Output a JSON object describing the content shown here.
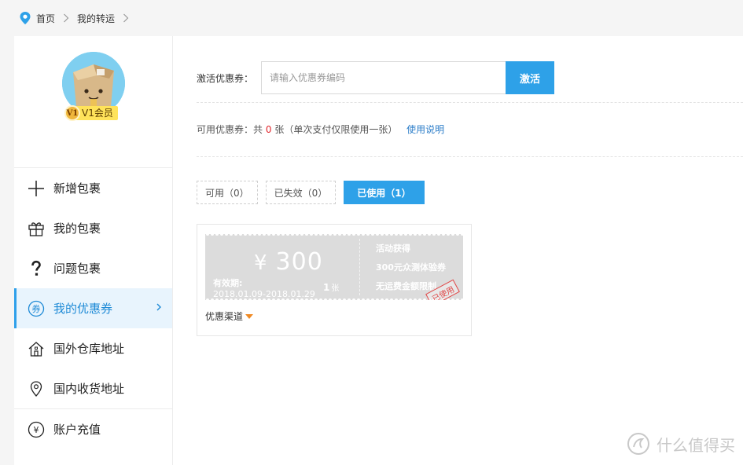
{
  "breadcrumb": {
    "home": "首页",
    "current": "我的转运"
  },
  "profile": {
    "vip_badge": "V1",
    "vip_label": "V1会员"
  },
  "sidebar": {
    "items": [
      {
        "label": "新增包裹",
        "icon": "plus-icon"
      },
      {
        "label": "我的包裹",
        "icon": "gift-box-icon"
      },
      {
        "label": "问题包裹",
        "icon": "question-icon"
      },
      {
        "label": "我的优惠券",
        "icon": "coupon-icon",
        "icon_char": "券",
        "active": true
      },
      {
        "label": "国外仓库地址",
        "icon": "house-icon"
      },
      {
        "label": "国内收货地址",
        "icon": "location-pin-icon"
      },
      {
        "label": "账户充值",
        "icon": "yen-icon",
        "icon_char": "¥"
      }
    ]
  },
  "activate": {
    "label": "激活优惠券：",
    "placeholder": "请输入优惠券编码",
    "button": "激活"
  },
  "info": {
    "prefix": "可用优惠券：共",
    "count": "0",
    "suffix": "张（单次支付仅限使用一张）",
    "link": "使用说明"
  },
  "tabs": [
    {
      "label": "可用（0）"
    },
    {
      "label": "已失效（0）"
    },
    {
      "label": "已使用（1）",
      "active": true
    }
  ],
  "coupon": {
    "currency": "¥",
    "amount": "300",
    "valid_label": "有效期:",
    "valid_range": "2018.01.09-2018.01.29",
    "quantity": "1",
    "quantity_unit": "张",
    "source": "活动获得",
    "name": "300元众测体验券",
    "condition": "无运费金额限制",
    "stamp": "已使用"
  },
  "channel": {
    "label": "优惠渠道"
  },
  "watermark": {
    "text": "什么值得买"
  },
  "colors": {
    "accent": "#2ea1e8",
    "active_bg": "#e8f4fd",
    "red": "#e0252b",
    "coupon_bg": "#dcdcdc"
  }
}
